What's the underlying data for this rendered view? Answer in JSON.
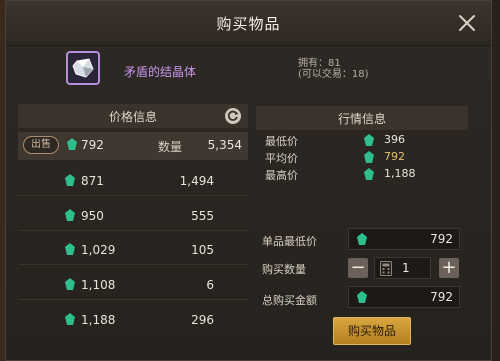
{
  "dialog": {
    "title": "购买物品"
  },
  "item": {
    "name": "矛盾的结晶体",
    "owned": "拥有：81",
    "tradable": "(可以交易：18)"
  },
  "price_panel": {
    "header": "价格信息",
    "sell_badge": "出售",
    "qty_label": "数量",
    "rows": [
      {
        "price": "792",
        "qty": "5,354"
      },
      {
        "price": "871",
        "qty": "1,494"
      },
      {
        "price": "950",
        "qty": "555"
      },
      {
        "price": "1,029",
        "qty": "105"
      },
      {
        "price": "1,108",
        "qty": "6"
      },
      {
        "price": "1,188",
        "qty": "296"
      }
    ]
  },
  "market_panel": {
    "header": "行情信息",
    "min_label": "最低价",
    "min_value": "396",
    "avg_label": "平均价",
    "avg_value": "792",
    "max_label": "最高价",
    "max_value": "1,188"
  },
  "purchase": {
    "unit_label": "单品最低价",
    "unit_value": "792",
    "qty_label": "购买数量",
    "qty_value": "1",
    "minus": "−",
    "plus": "+",
    "total_label": "总购买金额",
    "total_value": "792",
    "buy_button": "购买物品"
  },
  "colors": {
    "accent": "#d9a744",
    "item_rare": "#c995f0",
    "gem": "#2fbf8f",
    "avg_price": "#e8c072"
  }
}
